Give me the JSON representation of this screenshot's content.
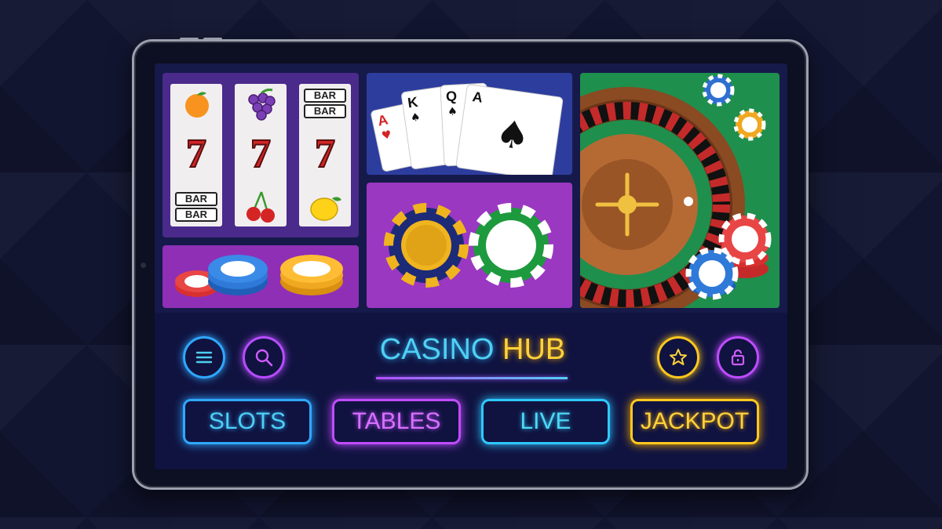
{
  "slots": {
    "reel1": {
      "top": "orange",
      "bottom": [
        "BAR",
        "BAR"
      ]
    },
    "reel2": {
      "top": "grapes",
      "bottom": "cherries"
    },
    "reel3": {
      "top": [
        "BAR",
        "BAR"
      ],
      "bottom": "lemon"
    },
    "sevens": [
      "7",
      "7",
      "7"
    ]
  },
  "cards": [
    "A",
    "K",
    "Q",
    "A"
  ],
  "brand": {
    "part1": "CASINO",
    "part2": "HUB"
  },
  "icons": {
    "menu": "menu-icon",
    "search": "search-icon",
    "favorites": "star-icon",
    "lock": "lock-icon"
  },
  "nav": {
    "slots": "SLOTS",
    "tables": "TABLES",
    "live": "LIVE",
    "jackpot": "JACKPOT"
  },
  "colors": {
    "cyan": "#4fd0f2",
    "purple": "#b84cff",
    "magenta": "#d05cff",
    "yellow": "#ffd23a"
  }
}
